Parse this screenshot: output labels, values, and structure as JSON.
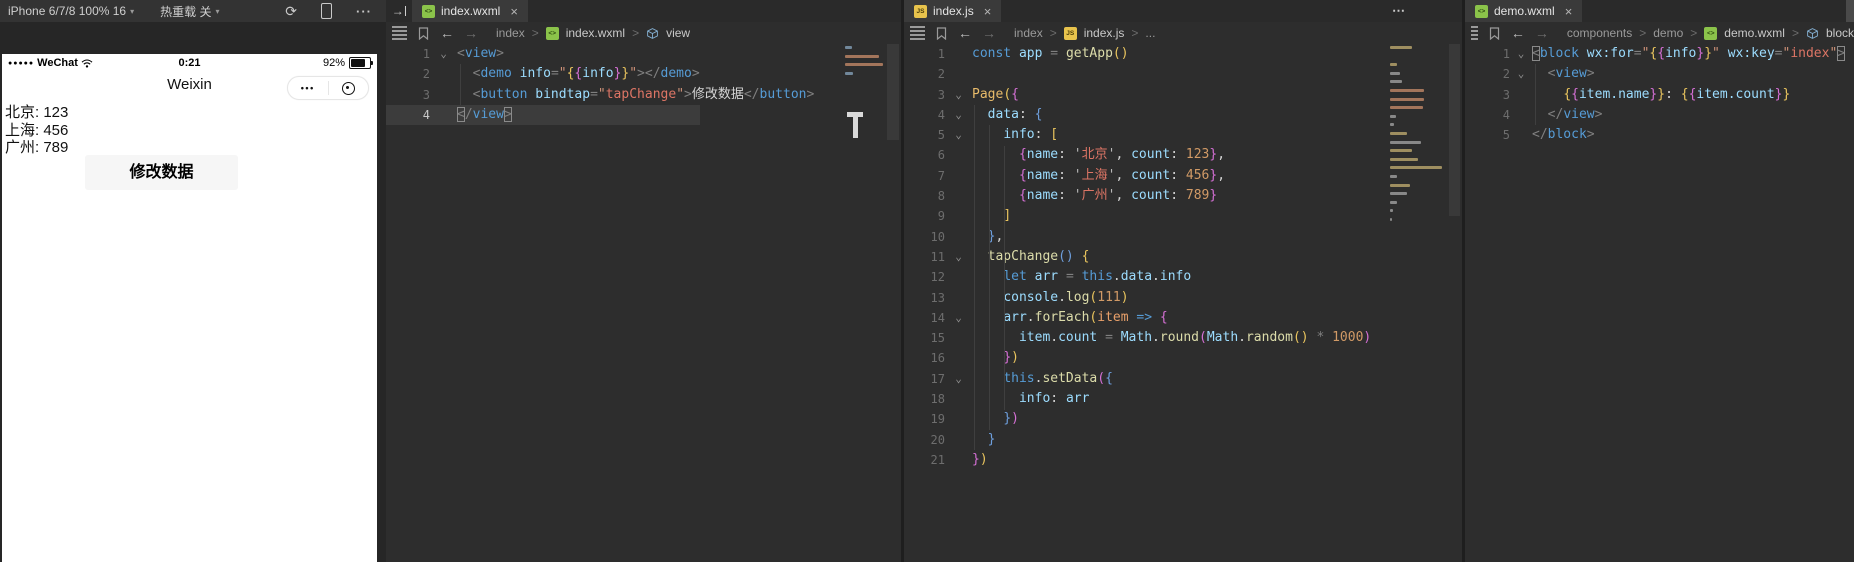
{
  "simulator": {
    "toolbar": {
      "device_selector": "iPhone 6/7/8 100% 16",
      "hot_reload": "热重载 关"
    },
    "phone": {
      "status_bar": {
        "carrier_dots": "●●●●●",
        "carrier": "WeChat",
        "time": "0:21",
        "battery_percent": "92%"
      },
      "nav": {
        "title": "Weixin",
        "capsule_dots": "•••"
      },
      "content_lines": [
        "北京: 123",
        "上海: 456",
        "广州: 789"
      ],
      "button_label": "修改数据"
    }
  },
  "icons": {
    "caret": "▾",
    "refresh": "⟳",
    "more": "···",
    "tab_more": "⋯",
    "back": "←",
    "forward": "→",
    "sidebar_toggle": "→",
    "crumb_sep": ">",
    "fold": "⌄",
    "close": "×",
    "wxml_glyph": "<>",
    "js_glyph": "JS"
  },
  "editors": [
    {
      "tab": {
        "label": "index.wxml"
      },
      "breadcrumb": [
        {
          "label": "index"
        },
        {
          "label": "index.wxml",
          "icon": "wxml"
        },
        {
          "label": "view",
          "icon": "symbol"
        }
      ],
      "lines": [
        {
          "n": 1,
          "fold": true,
          "seg": [
            [
              "<",
              "dim"
            ],
            [
              "view",
              "tag"
            ],
            [
              ">",
              "dim"
            ]
          ]
        },
        {
          "n": 2,
          "seg": [
            [
              "  ",
              "txt"
            ],
            [
              "<",
              "dim"
            ],
            [
              "demo",
              "tag"
            ],
            [
              " ",
              "txt"
            ],
            [
              "info",
              "attr"
            ],
            [
              "=",
              "dim"
            ],
            [
              "\"",
              "str"
            ],
            [
              "{",
              "b1"
            ],
            [
              "{",
              "b2"
            ],
            [
              "info",
              "var"
            ],
            [
              "}",
              "b2"
            ],
            [
              "}",
              "b1"
            ],
            [
              "\"",
              "str"
            ],
            [
              ">",
              "dim"
            ],
            [
              "</",
              "dim"
            ],
            [
              "demo",
              "tag"
            ],
            [
              ">",
              "dim"
            ]
          ]
        },
        {
          "n": 3,
          "seg": [
            [
              "  ",
              "txt"
            ],
            [
              "<",
              "dim"
            ],
            [
              "button",
              "tag"
            ],
            [
              " ",
              "txt"
            ],
            [
              "bindtap",
              "attr"
            ],
            [
              "=",
              "dim"
            ],
            [
              "\"",
              "str"
            ],
            [
              "tapChange",
              "strr"
            ],
            [
              "\"",
              "str"
            ],
            [
              ">",
              "dim"
            ],
            [
              "修改数据",
              "txt"
            ],
            [
              "</",
              "dim"
            ],
            [
              "button",
              "tag"
            ],
            [
              ">",
              "dim"
            ]
          ]
        },
        {
          "n": 4,
          "hl": true,
          "seg": [
            [
              "<",
              "dim m"
            ],
            [
              "/",
              "dim"
            ],
            [
              "view",
              "tag"
            ],
            [
              ">",
              "dim m"
            ]
          ]
        }
      ]
    },
    {
      "tab": {
        "label": "index.js"
      },
      "breadcrumb": [
        {
          "label": "index"
        },
        {
          "label": "index.js",
          "icon": "js"
        },
        {
          "label": "..."
        }
      ],
      "lines": [
        {
          "n": 1,
          "seg": [
            [
              "const",
              "kw"
            ],
            [
              " ",
              "txt"
            ],
            [
              "app",
              "var"
            ],
            [
              " ",
              "txt"
            ],
            [
              "=",
              "dim"
            ],
            [
              " ",
              "txt"
            ],
            [
              "getApp",
              "fn"
            ],
            [
              "()",
              "b1"
            ]
          ]
        },
        {
          "n": 2,
          "seg": [
            [
              "",
              "txt"
            ]
          ]
        },
        {
          "n": 3,
          "fold": true,
          "seg": [
            [
              "Page",
              "fn2"
            ],
            [
              "(",
              "b1"
            ],
            [
              "{",
              "b2"
            ]
          ]
        },
        {
          "n": 4,
          "fold": true,
          "seg": [
            [
              "  ",
              "txt"
            ],
            [
              "data",
              "var"
            ],
            [
              ": ",
              "txt"
            ],
            [
              "{",
              "b3"
            ]
          ]
        },
        {
          "n": 5,
          "fold": true,
          "seg": [
            [
              "    ",
              "txt"
            ],
            [
              "info",
              "var"
            ],
            [
              ": ",
              "txt"
            ],
            [
              "[",
              "b1"
            ]
          ]
        },
        {
          "n": 6,
          "seg": [
            [
              "      ",
              "txt"
            ],
            [
              "{",
              "b2"
            ],
            [
              "name",
              "var"
            ],
            [
              ": ",
              "txt"
            ],
            [
              "'",
              "q"
            ],
            [
              "北京",
              "strr"
            ],
            [
              "'",
              "q"
            ],
            [
              ", ",
              "txt"
            ],
            [
              "count",
              "var"
            ],
            [
              ": ",
              "txt"
            ],
            [
              "123",
              "num"
            ],
            [
              "}",
              "b2"
            ],
            [
              ",",
              "txt"
            ]
          ]
        },
        {
          "n": 7,
          "seg": [
            [
              "      ",
              "txt"
            ],
            [
              "{",
              "b2"
            ],
            [
              "name",
              "var"
            ],
            [
              ": ",
              "txt"
            ],
            [
              "'",
              "q"
            ],
            [
              "上海",
              "strr"
            ],
            [
              "'",
              "q"
            ],
            [
              ", ",
              "txt"
            ],
            [
              "count",
              "var"
            ],
            [
              ": ",
              "txt"
            ],
            [
              "456",
              "num"
            ],
            [
              "}",
              "b2"
            ],
            [
              ",",
              "txt"
            ]
          ]
        },
        {
          "n": 8,
          "seg": [
            [
              "      ",
              "txt"
            ],
            [
              "{",
              "b2"
            ],
            [
              "name",
              "var"
            ],
            [
              ": ",
              "txt"
            ],
            [
              "'",
              "q"
            ],
            [
              "广州",
              "strr"
            ],
            [
              "'",
              "q"
            ],
            [
              ", ",
              "txt"
            ],
            [
              "count",
              "var"
            ],
            [
              ": ",
              "txt"
            ],
            [
              "789",
              "num"
            ],
            [
              "}",
              "b2"
            ]
          ]
        },
        {
          "n": 9,
          "seg": [
            [
              "    ",
              "txt"
            ],
            [
              "]",
              "b1"
            ]
          ]
        },
        {
          "n": 10,
          "seg": [
            [
              "  ",
              "txt"
            ],
            [
              "}",
              "b3"
            ],
            [
              ",",
              "txt"
            ]
          ]
        },
        {
          "n": 11,
          "fold": true,
          "seg": [
            [
              "  ",
              "txt"
            ],
            [
              "tapChange",
              "fn"
            ],
            [
              "()",
              "b3"
            ],
            [
              " ",
              "txt"
            ],
            [
              "{",
              "b1"
            ]
          ]
        },
        {
          "n": 12,
          "seg": [
            [
              "    ",
              "txt"
            ],
            [
              "let",
              "kw"
            ],
            [
              " ",
              "txt"
            ],
            [
              "arr",
              "var"
            ],
            [
              " ",
              "txt"
            ],
            [
              "=",
              "dim"
            ],
            [
              " ",
              "txt"
            ],
            [
              "this",
              "kw"
            ],
            [
              ".",
              "txt"
            ],
            [
              "data",
              "var"
            ],
            [
              ".",
              "txt"
            ],
            [
              "info",
              "var"
            ]
          ]
        },
        {
          "n": 13,
          "seg": [
            [
              "    ",
              "txt"
            ],
            [
              "console",
              "var"
            ],
            [
              ".",
              "txt"
            ],
            [
              "log",
              "fn"
            ],
            [
              "(",
              "b1"
            ],
            [
              "111",
              "num"
            ],
            [
              ")",
              "b1"
            ]
          ]
        },
        {
          "n": 14,
          "fold": true,
          "seg": [
            [
              "    ",
              "txt"
            ],
            [
              "arr",
              "var"
            ],
            [
              ".",
              "txt"
            ],
            [
              "forEach",
              "fn"
            ],
            [
              "(",
              "b1"
            ],
            [
              "item",
              "param"
            ],
            [
              " ",
              "txt"
            ],
            [
              "=>",
              "kw"
            ],
            [
              " ",
              "txt"
            ],
            [
              "{",
              "b2"
            ]
          ]
        },
        {
          "n": 15,
          "seg": [
            [
              "      ",
              "txt"
            ],
            [
              "item",
              "var"
            ],
            [
              ".",
              "txt"
            ],
            [
              "count",
              "var"
            ],
            [
              " ",
              "txt"
            ],
            [
              "=",
              "dim"
            ],
            [
              " ",
              "txt"
            ],
            [
              "Math",
              "var"
            ],
            [
              ".",
              "txt"
            ],
            [
              "round",
              "fn"
            ],
            [
              "(",
              "b2"
            ],
            [
              "Math",
              "var"
            ],
            [
              ".",
              "txt"
            ],
            [
              "random",
              "fn"
            ],
            [
              "()",
              "b1"
            ],
            [
              " ",
              "txt"
            ],
            [
              "*",
              "dim"
            ],
            [
              " ",
              "txt"
            ],
            [
              "1000",
              "num"
            ],
            [
              ")",
              "b2"
            ]
          ]
        },
        {
          "n": 16,
          "seg": [
            [
              "    ",
              "txt"
            ],
            [
              "}",
              "b2"
            ],
            [
              ")",
              "b1"
            ]
          ]
        },
        {
          "n": 17,
          "fold": true,
          "seg": [
            [
              "    ",
              "txt"
            ],
            [
              "this",
              "kw"
            ],
            [
              ".",
              "txt"
            ],
            [
              "setData",
              "fn"
            ],
            [
              "(",
              "b2"
            ],
            [
              "{",
              "b3"
            ]
          ]
        },
        {
          "n": 18,
          "seg": [
            [
              "      ",
              "txt"
            ],
            [
              "info",
              "var"
            ],
            [
              ": ",
              "txt"
            ],
            [
              "arr",
              "var"
            ]
          ]
        },
        {
          "n": 19,
          "seg": [
            [
              "    ",
              "txt"
            ],
            [
              "}",
              "b3"
            ],
            [
              ")",
              "b2"
            ]
          ]
        },
        {
          "n": 20,
          "seg": [
            [
              "  ",
              "txt"
            ],
            [
              "}",
              "b3"
            ]
          ]
        },
        {
          "n": 21,
          "seg": [
            [
              "}",
              "b2"
            ],
            [
              ")",
              "b1"
            ]
          ]
        }
      ]
    },
    {
      "tab": {
        "label": "demo.wxml"
      },
      "breadcrumb": [
        {
          "label": "components"
        },
        {
          "label": "demo"
        },
        {
          "label": "demo.wxml",
          "icon": "wxml"
        },
        {
          "label": "block",
          "icon": "symbol"
        }
      ],
      "lines": [
        {
          "n": 1,
          "fold": true,
          "seg": [
            [
              "<",
              "dim m"
            ],
            [
              "block",
              "tag"
            ],
            [
              " ",
              "txt"
            ],
            [
              "wx:for",
              "attr"
            ],
            [
              "=",
              "dim"
            ],
            [
              "\"",
              "str"
            ],
            [
              "{",
              "b1"
            ],
            [
              "{",
              "b2"
            ],
            [
              "info",
              "var"
            ],
            [
              "}",
              "b2"
            ],
            [
              "}",
              "b1"
            ],
            [
              "\"",
              "str"
            ],
            [
              " ",
              "txt"
            ],
            [
              "wx:key",
              "attr"
            ],
            [
              "=",
              "dim"
            ],
            [
              "\"",
              "str"
            ],
            [
              "index",
              "strr"
            ],
            [
              "\"",
              "str"
            ],
            [
              ">",
              "dim m"
            ]
          ]
        },
        {
          "n": 2,
          "fold": true,
          "seg": [
            [
              "  ",
              "txt"
            ],
            [
              "<",
              "dim"
            ],
            [
              "view",
              "tag"
            ],
            [
              ">",
              "dim"
            ]
          ]
        },
        {
          "n": 3,
          "seg": [
            [
              "    ",
              "txt"
            ],
            [
              "{",
              "b1"
            ],
            [
              "{",
              "b2"
            ],
            [
              "item.name",
              "var"
            ],
            [
              "}",
              "b2"
            ],
            [
              "}",
              "b1"
            ],
            [
              ":",
              "txt"
            ],
            [
              " ",
              "txt"
            ],
            [
              "{",
              "b1"
            ],
            [
              "{",
              "b2"
            ],
            [
              "item.count",
              "var"
            ],
            [
              "}",
              "b2"
            ],
            [
              "}",
              "b1"
            ]
          ]
        },
        {
          "n": 4,
          "seg": [
            [
              "  ",
              "txt"
            ],
            [
              "</",
              "dim"
            ],
            [
              "view",
              "tag"
            ],
            [
              ">",
              "dim"
            ]
          ]
        },
        {
          "n": 5,
          "seg": [
            [
              "</",
              "dim"
            ],
            [
              "block",
              "tag"
            ],
            [
              ">",
              "dim"
            ]
          ]
        }
      ]
    }
  ],
  "colors": {
    "toolbar_bg": "#333333",
    "editor_bg": "#2d2d2d",
    "tab_bar_bg": "#2a2a2a",
    "active_tab_bg": "#3a3a3a",
    "line_highlight": "#3c3c3c",
    "tag": "#569cd6",
    "attribute": "#9cdcfe",
    "keyword": "#569cd6",
    "variable": "#9cdcfe",
    "function": "#dcdcaa",
    "string": "#ce9178",
    "string_red": "#dd7565",
    "number": "#d19a66",
    "bracket_gold": "#eac55e",
    "bracket_purple": "#d670d6",
    "bracket_blue": "#6e9fdd",
    "wxml_icon": "#8bc34a",
    "js_icon": "#e8c34c"
  }
}
